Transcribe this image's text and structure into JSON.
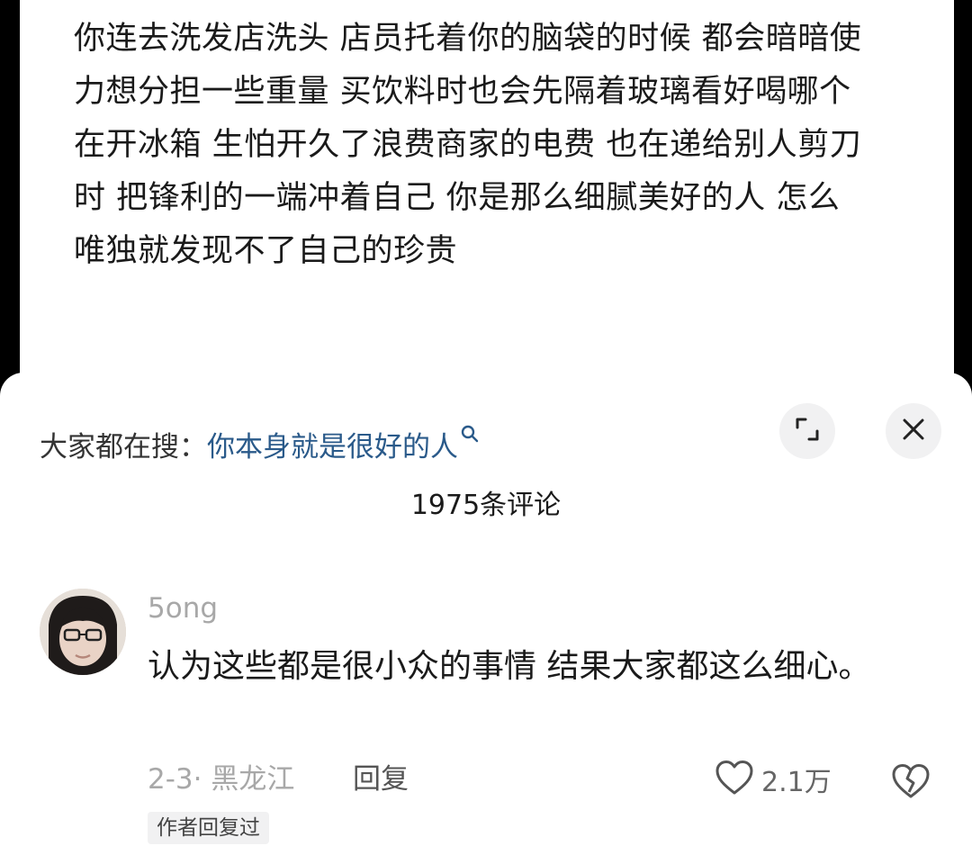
{
  "post": {
    "text": "你连去洗发店洗头 店员托着你的脑袋的时候 都会暗暗使力想分担一些重量 买饮料时也会先隔着玻璃看好喝哪个在开冰箱 生怕开久了浪费商家的电费 也在递给别人剪刀时 把锋利的一端冲着自己 你是那么细腻美好的人 怎么唯独就发现不了自己的珍贵"
  },
  "search": {
    "prefix": "大家都在搜：",
    "query": "你本身就是很好的人",
    "icon": "search-icon"
  },
  "buttons": {
    "expand_icon": "expand-icon",
    "close_icon": "close-icon"
  },
  "comments_header": {
    "title": "1975条评论"
  },
  "comment": {
    "username": "5ong",
    "avatar_icon": "avatar",
    "text": "认为这些都是很小众的事情 结果大家都这么细心。",
    "date_location": "2-3· 黑龙江",
    "reply_label": "回复",
    "like_count": "2.1万",
    "like_icon": "heart-icon",
    "dislike_icon": "broken-heart-icon",
    "author_badge": "作者回复过"
  },
  "colors": {
    "search_query": "#2a5a8a",
    "muted_text": "#a8a8a8",
    "button_bg": "#f1f1f2"
  }
}
